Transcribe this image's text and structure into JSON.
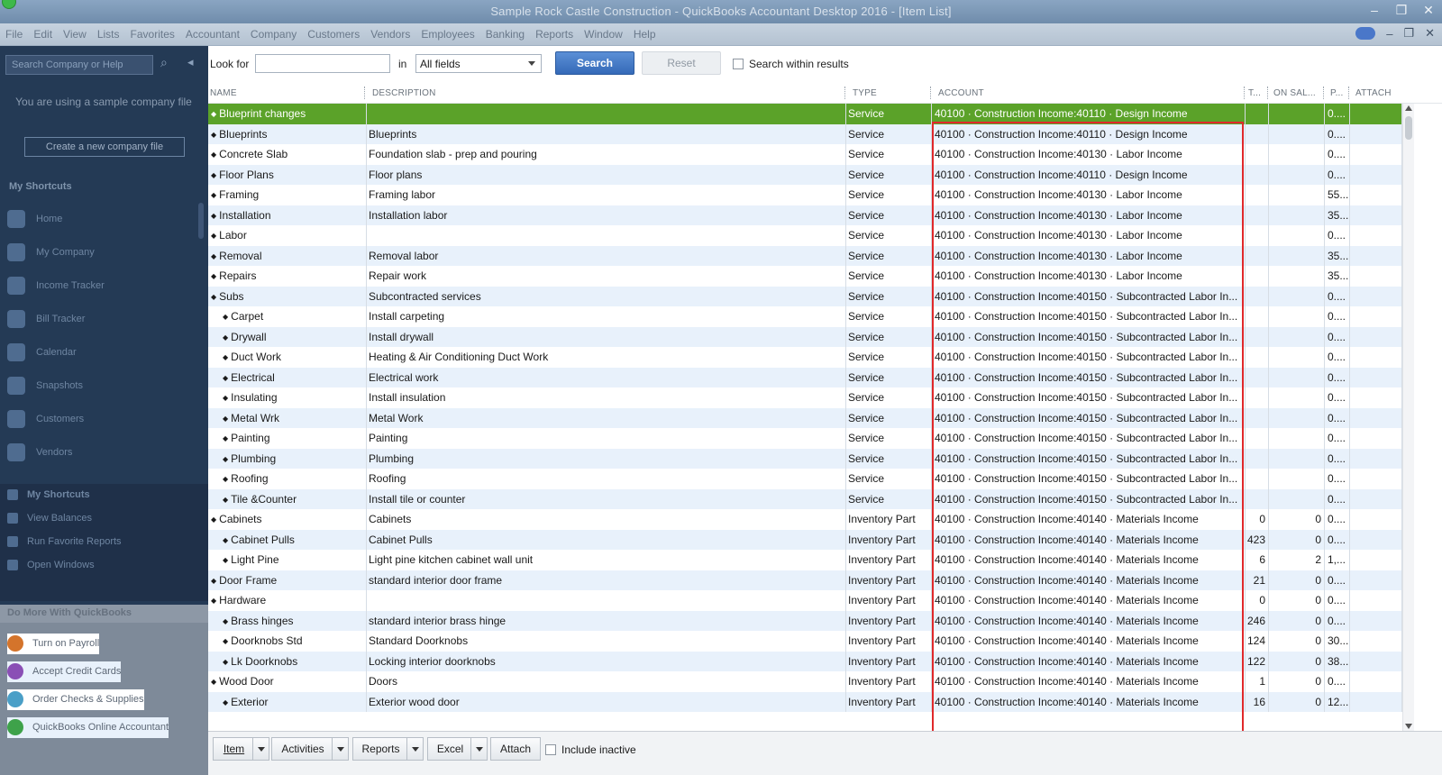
{
  "window": {
    "title": "Sample Rock Castle Construction - QuickBooks Accountant Desktop 2016 - [Item List]"
  },
  "menu": [
    "File",
    "Edit",
    "View",
    "Lists",
    "Favorites",
    "Accountant",
    "Company",
    "Customers",
    "Vendors",
    "Employees",
    "Banking",
    "Reports",
    "Window",
    "Help"
  ],
  "leftnav": {
    "search_placeholder": "Search Company or Help",
    "sample_text": "You are using a sample company file",
    "create_button": "Create a new company file",
    "my_shortcuts_header": "My Shortcuts",
    "items": [
      "Home",
      "My Company",
      "Income Tracker",
      "Bill Tracker",
      "Calendar",
      "Snapshots",
      "Customers",
      "Vendors"
    ],
    "bottom": [
      "My Shortcuts",
      "View Balances",
      "Run Favorite Reports",
      "Open Windows"
    ],
    "more_header": "Do More With QuickBooks",
    "more_items": [
      "Turn on Payroll",
      "Accept Credit Cards",
      "Order Checks & Supplies",
      "QuickBooks Online Accountant"
    ]
  },
  "toolbar": {
    "look_for_label": "Look for",
    "in_label": "in",
    "field_value": "All fields",
    "search_label": "Search",
    "reset_label": "Reset",
    "within_label": "Search within results"
  },
  "grid": {
    "headers": {
      "name": "NAME",
      "description": "DESCRIPTION",
      "type": "TYPE",
      "account": "ACCOUNT",
      "t": "T...",
      "on_sales": "ON SAL...",
      "p": "P...",
      "attach": "ATTACH"
    },
    "rows": [
      {
        "name": "Blueprint changes",
        "indent": false,
        "desc": "",
        "type": "Service",
        "account": "40100 · Construction Income:40110 · Design Income",
        "t": "",
        "sal": "",
        "p": "0...."
      },
      {
        "name": "Blueprints",
        "indent": false,
        "desc": "Blueprints",
        "type": "Service",
        "account": "40100 · Construction Income:40110 · Design Income",
        "t": "",
        "sal": "",
        "p": "0...."
      },
      {
        "name": "Concrete Slab",
        "indent": false,
        "desc": "Foundation slab - prep and pouring",
        "type": "Service",
        "account": "40100 · Construction Income:40130 · Labor Income",
        "t": "",
        "sal": "",
        "p": "0...."
      },
      {
        "name": "Floor Plans",
        "indent": false,
        "desc": "Floor plans",
        "type": "Service",
        "account": "40100 · Construction Income:40110 · Design Income",
        "t": "",
        "sal": "",
        "p": "0...."
      },
      {
        "name": "Framing",
        "indent": false,
        "desc": "Framing labor",
        "type": "Service",
        "account": "40100 · Construction Income:40130 · Labor Income",
        "t": "",
        "sal": "",
        "p": "55...."
      },
      {
        "name": "Installation",
        "indent": false,
        "desc": "Installation labor",
        "type": "Service",
        "account": "40100 · Construction Income:40130 · Labor Income",
        "t": "",
        "sal": "",
        "p": "35...."
      },
      {
        "name": "Labor",
        "indent": false,
        "desc": "",
        "type": "Service",
        "account": "40100 · Construction Income:40130 · Labor Income",
        "t": "",
        "sal": "",
        "p": "0...."
      },
      {
        "name": "Removal",
        "indent": false,
        "desc": "Removal labor",
        "type": "Service",
        "account": "40100 · Construction Income:40130 · Labor Income",
        "t": "",
        "sal": "",
        "p": "35...."
      },
      {
        "name": "Repairs",
        "indent": false,
        "desc": "Repair work",
        "type": "Service",
        "account": "40100 · Construction Income:40130 · Labor Income",
        "t": "",
        "sal": "",
        "p": "35...."
      },
      {
        "name": "Subs",
        "indent": false,
        "desc": "Subcontracted services",
        "type": "Service",
        "account": "40100 · Construction Income:40150 · Subcontracted Labor In...",
        "t": "",
        "sal": "",
        "p": "0...."
      },
      {
        "name": "Carpet",
        "indent": true,
        "desc": "Install carpeting",
        "type": "Service",
        "account": "40100 · Construction Income:40150 · Subcontracted Labor In...",
        "t": "",
        "sal": "",
        "p": "0...."
      },
      {
        "name": "Drywall",
        "indent": true,
        "desc": "Install drywall",
        "type": "Service",
        "account": "40100 · Construction Income:40150 · Subcontracted Labor In...",
        "t": "",
        "sal": "",
        "p": "0...."
      },
      {
        "name": "Duct Work",
        "indent": true,
        "desc": "Heating & Air Conditioning Duct Work",
        "type": "Service",
        "account": "40100 · Construction Income:40150 · Subcontracted Labor In...",
        "t": "",
        "sal": "",
        "p": "0...."
      },
      {
        "name": "Electrical",
        "indent": true,
        "desc": "Electrical work",
        "type": "Service",
        "account": "40100 · Construction Income:40150 · Subcontracted Labor In...",
        "t": "",
        "sal": "",
        "p": "0...."
      },
      {
        "name": "Insulating",
        "indent": true,
        "desc": "Install insulation",
        "type": "Service",
        "account": "40100 · Construction Income:40150 · Subcontracted Labor In...",
        "t": "",
        "sal": "",
        "p": "0...."
      },
      {
        "name": "Metal Wrk",
        "indent": true,
        "desc": "Metal Work",
        "type": "Service",
        "account": "40100 · Construction Income:40150 · Subcontracted Labor In...",
        "t": "",
        "sal": "",
        "p": "0...."
      },
      {
        "name": "Painting",
        "indent": true,
        "desc": "Painting",
        "type": "Service",
        "account": "40100 · Construction Income:40150 · Subcontracted Labor In...",
        "t": "",
        "sal": "",
        "p": "0...."
      },
      {
        "name": "Plumbing",
        "indent": true,
        "desc": "Plumbing",
        "type": "Service",
        "account": "40100 · Construction Income:40150 · Subcontracted Labor In...",
        "t": "",
        "sal": "",
        "p": "0...."
      },
      {
        "name": "Roofing",
        "indent": true,
        "desc": "Roofing",
        "type": "Service",
        "account": "40100 · Construction Income:40150 · Subcontracted Labor In...",
        "t": "",
        "sal": "",
        "p": "0...."
      },
      {
        "name": "Tile &Counter",
        "indent": true,
        "desc": "Install tile or counter",
        "type": "Service",
        "account": "40100 · Construction Income:40150 · Subcontracted Labor In...",
        "t": "",
        "sal": "",
        "p": "0...."
      },
      {
        "name": "Cabinets",
        "indent": false,
        "desc": "Cabinets",
        "type": "Inventory Part",
        "account": "40100 · Construction Income:40140 · Materials Income",
        "t": "0",
        "sal": "0",
        "p": "0...."
      },
      {
        "name": "Cabinet Pulls",
        "indent": true,
        "desc": "Cabinet Pulls",
        "type": "Inventory Part",
        "account": "40100 · Construction Income:40140 · Materials Income",
        "t": "423",
        "sal": "0",
        "p": "0...."
      },
      {
        "name": "Light Pine",
        "indent": true,
        "desc": "Light pine kitchen cabinet wall unit",
        "type": "Inventory Part",
        "account": "40100 · Construction Income:40140 · Materials Income",
        "t": "6",
        "sal": "2",
        "p": "1,..."
      },
      {
        "name": "Door Frame",
        "indent": false,
        "desc": "standard interior door frame",
        "type": "Inventory Part",
        "account": "40100 · Construction Income:40140 · Materials Income",
        "t": "21",
        "sal": "0",
        "p": "0...."
      },
      {
        "name": "Hardware",
        "indent": false,
        "desc": "",
        "type": "Inventory Part",
        "account": "40100 · Construction Income:40140 · Materials Income",
        "t": "0",
        "sal": "0",
        "p": "0...."
      },
      {
        "name": "Brass hinges",
        "indent": true,
        "desc": "standard interior brass hinge",
        "type": "Inventory Part",
        "account": "40100 · Construction Income:40140 · Materials Income",
        "t": "246",
        "sal": "0",
        "p": "0...."
      },
      {
        "name": "Doorknobs Std",
        "indent": true,
        "desc": "Standard Doorknobs",
        "type": "Inventory Part",
        "account": "40100 · Construction Income:40140 · Materials Income",
        "t": "124",
        "sal": "0",
        "p": "30...."
      },
      {
        "name": "Lk Doorknobs",
        "indent": true,
        "desc": "Locking interior doorknobs",
        "type": "Inventory Part",
        "account": "40100 · Construction Income:40140 · Materials Income",
        "t": "122",
        "sal": "0",
        "p": "38...."
      },
      {
        "name": "Wood Door",
        "indent": false,
        "desc": "Doors",
        "type": "Inventory Part",
        "account": "40100 · Construction Income:40140 · Materials Income",
        "t": "1",
        "sal": "0",
        "p": "0...."
      },
      {
        "name": "Exterior",
        "indent": true,
        "desc": "Exterior wood door",
        "type": "Inventory Part",
        "account": "40100 · Construction Income:40140 · Materials Income",
        "t": "16",
        "sal": "0",
        "p": "12...."
      }
    ]
  },
  "bottombar": {
    "item": "Item",
    "activities": "Activities",
    "reports": "Reports",
    "excel": "Excel",
    "attach": "Attach",
    "include_inactive": "Include inactive"
  },
  "colors": {
    "selected_row": "#5ba229",
    "alt_row": "#e8f1fb",
    "search_button": "#356ab8",
    "highlight_box": "#e0292b",
    "nav_bg": "#243a55"
  }
}
